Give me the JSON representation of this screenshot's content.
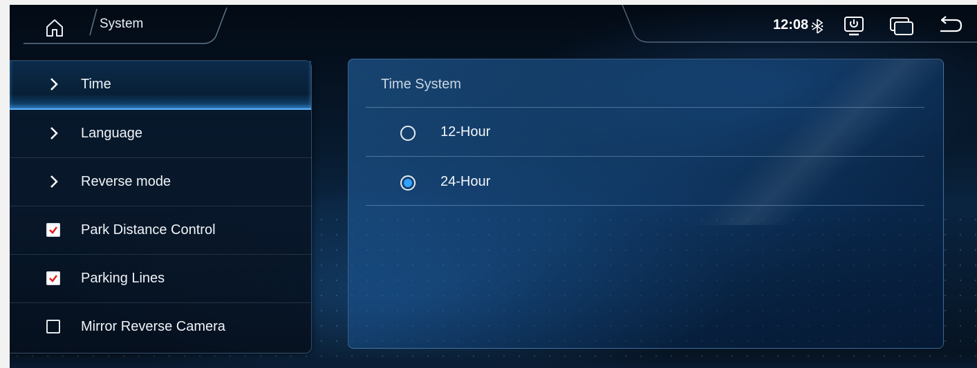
{
  "topbar": {
    "breadcrumb": "System",
    "clock": "12:08",
    "icons": [
      "home-icon",
      "bluetooth-icon",
      "screen-power-icon",
      "window-switch-icon",
      "back-icon"
    ]
  },
  "menu": {
    "items": [
      {
        "label": "Time",
        "kind": "chevron",
        "active": true
      },
      {
        "label": "Language",
        "kind": "chevron",
        "active": false
      },
      {
        "label": "Reverse mode",
        "kind": "chevron",
        "active": false
      },
      {
        "label": "Park Distance Control",
        "kind": "checkbox",
        "checked": true
      },
      {
        "label": "Parking Lines",
        "kind": "checkbox",
        "checked": true
      },
      {
        "label": "Mirror Reverse Camera",
        "kind": "checkbox",
        "checked": false
      }
    ]
  },
  "panel": {
    "title": "Time System",
    "options": [
      {
        "label": "12-Hour",
        "selected": false
      },
      {
        "label": "24-Hour",
        "selected": true
      }
    ]
  },
  "colors": {
    "accent": "#2fa3ff",
    "check": "#e02020",
    "background": "#071a2e"
  }
}
